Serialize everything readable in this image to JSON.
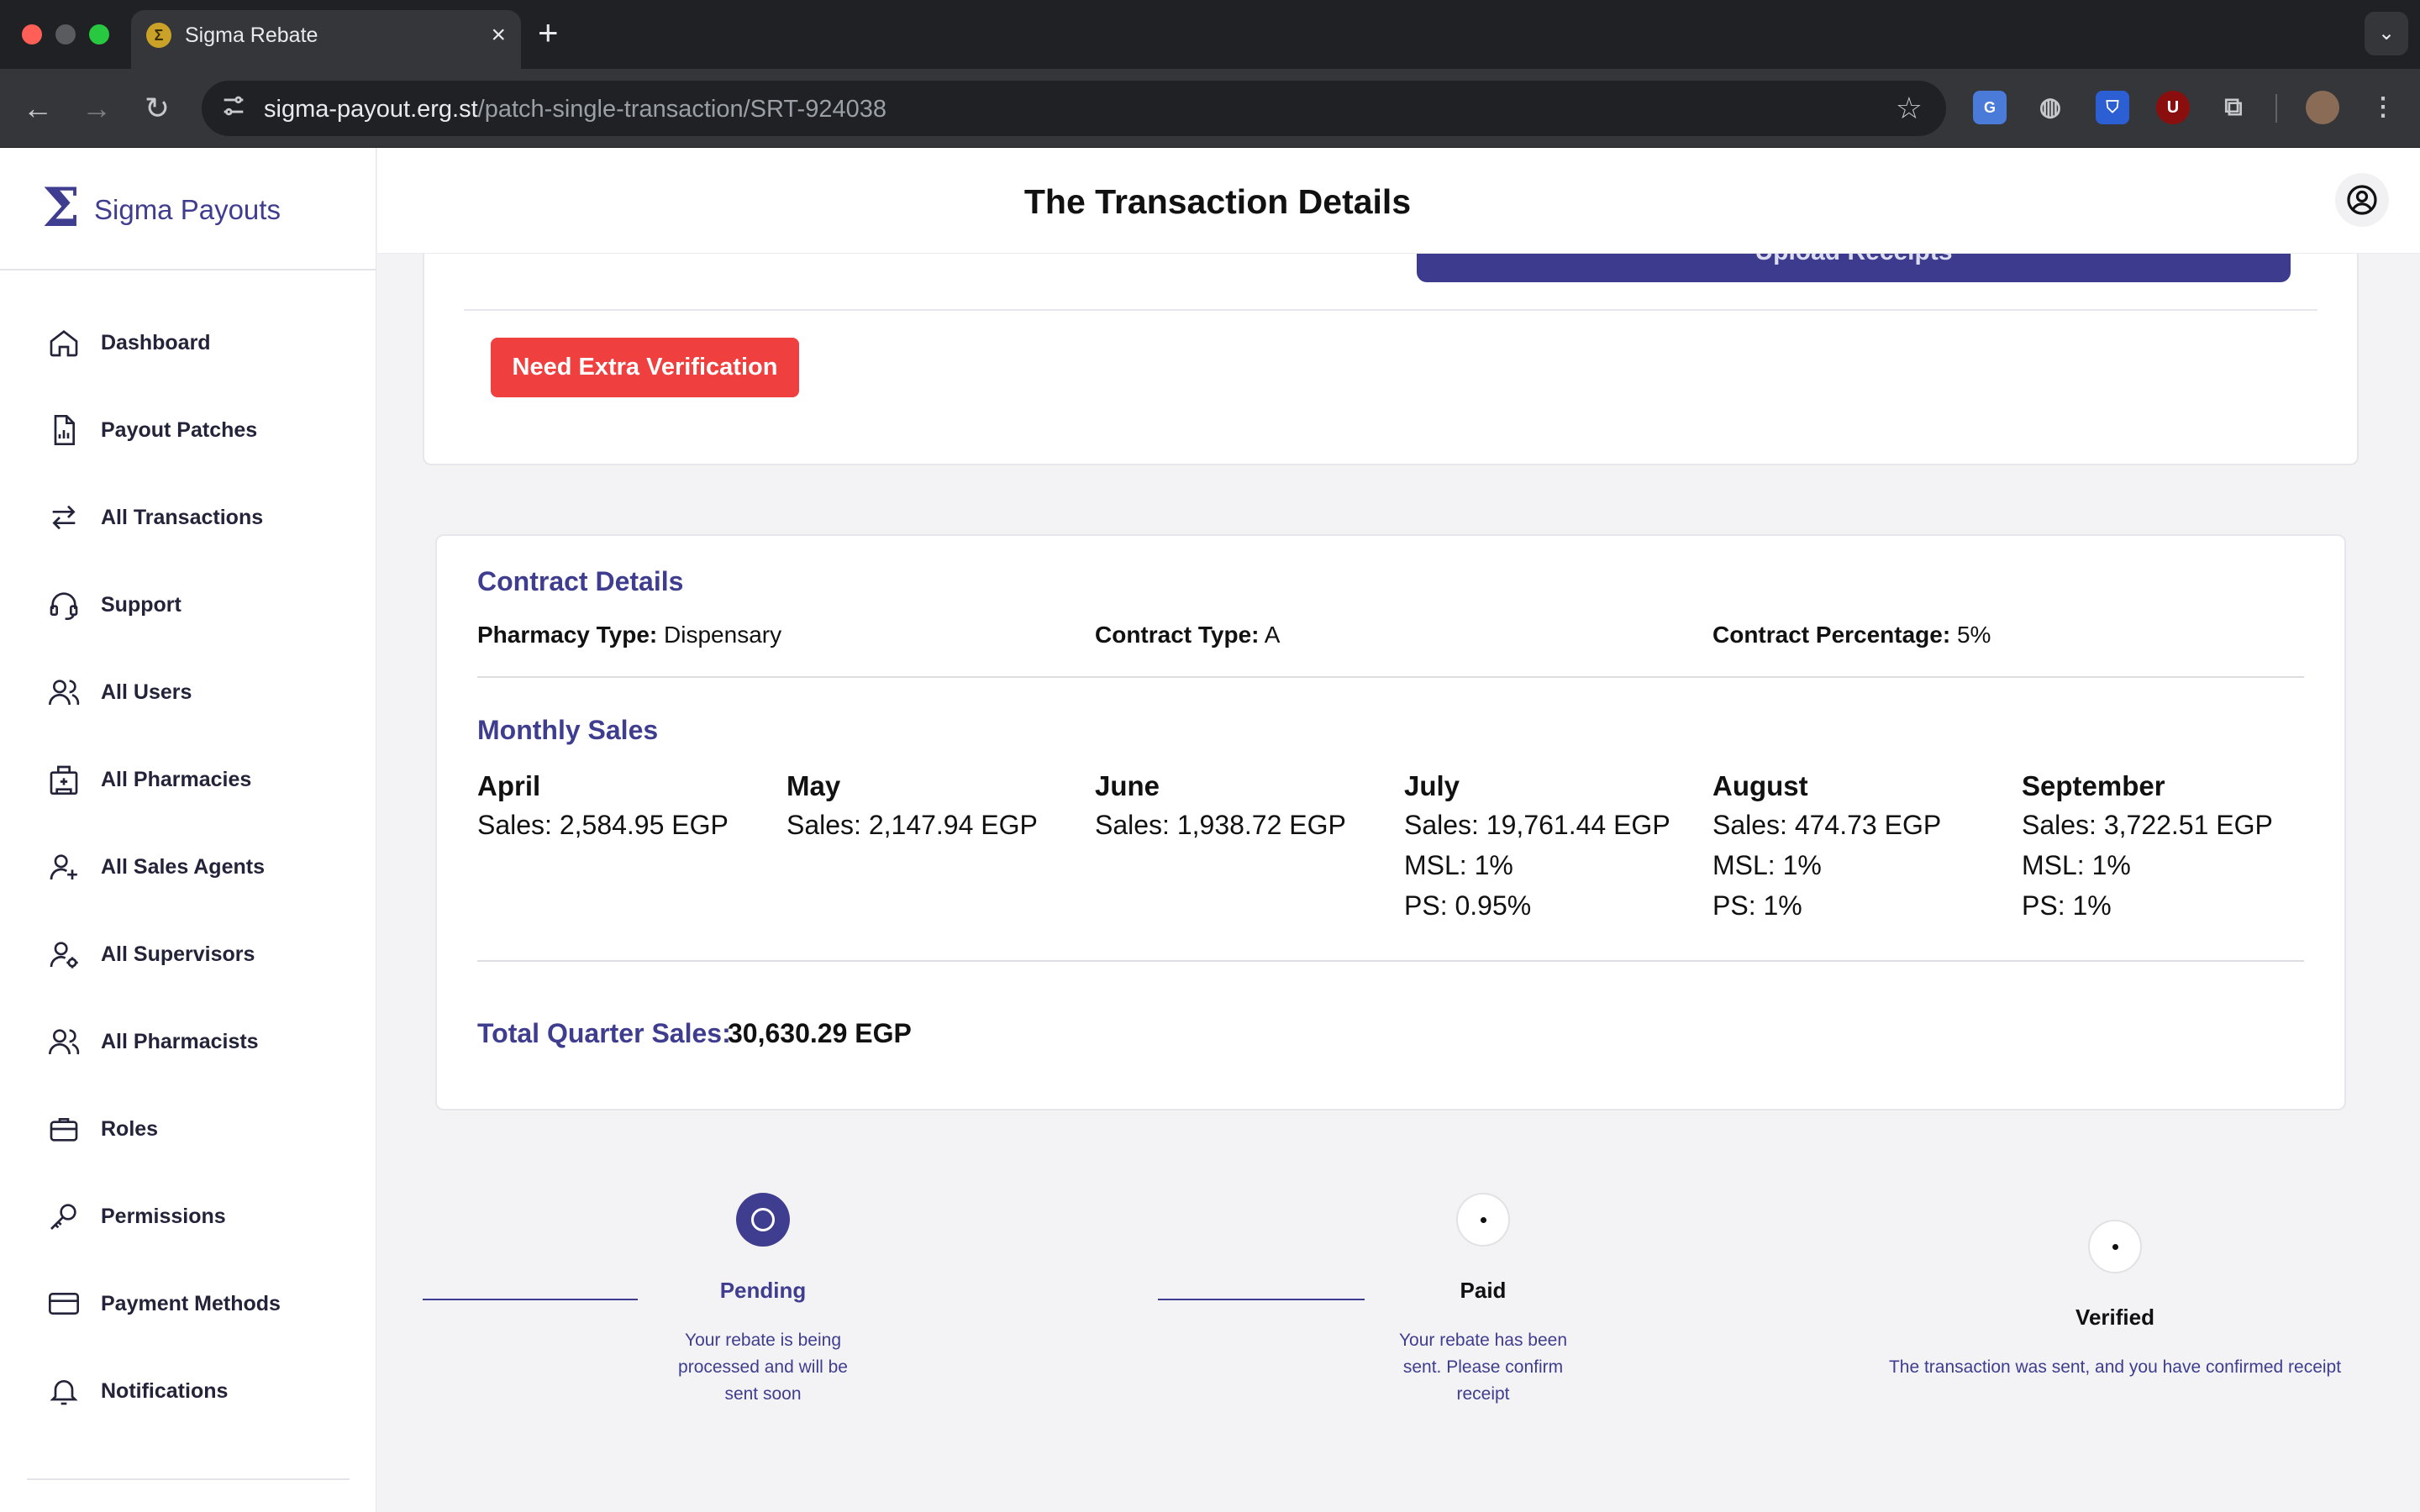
{
  "browser": {
    "tab_title": "Sigma Rebate",
    "favicon_glyph": "Σ",
    "url_host": "sigma-payout.erg.st",
    "url_path": "/patch-single-transaction/SRT-924038",
    "extension_u_label": "U"
  },
  "sidebar": {
    "brand_glyph": "Σ",
    "brand_name": "Sigma Payouts",
    "items": [
      {
        "label": "Dashboard",
        "icon": "home-icon"
      },
      {
        "label": "Payout Patches",
        "icon": "document-chart-icon"
      },
      {
        "label": "All Transactions",
        "icon": "arrows-exchange-icon"
      },
      {
        "label": "Support",
        "icon": "headset-icon"
      },
      {
        "label": "All Users",
        "icon": "users-icon"
      },
      {
        "label": "All Pharmacies",
        "icon": "building-icon"
      },
      {
        "label": "All Sales Agents",
        "icon": "user-plus-icon"
      },
      {
        "label": "All Supervisors",
        "icon": "user-gear-icon"
      },
      {
        "label": "All Pharmacists",
        "icon": "users-icon"
      },
      {
        "label": "Roles",
        "icon": "briefcase-icon"
      },
      {
        "label": "Permissions",
        "icon": "key-icon"
      },
      {
        "label": "Payment Methods",
        "icon": "credit-card-icon"
      },
      {
        "label": "Notifications",
        "icon": "bell-icon"
      }
    ]
  },
  "header": {
    "title": "The Transaction Details"
  },
  "top_card": {
    "upload_label": "Upload Receipts",
    "verify_label": "Need Extra Verification"
  },
  "contract": {
    "title": "Contract Details",
    "pharmacy_type_label": "Pharmacy Type:",
    "pharmacy_type_value": "Dispensary",
    "contract_type_label": "Contract Type:",
    "contract_type_value": "A",
    "contract_percentage_label": "Contract Percentage:",
    "contract_percentage_value": "5%"
  },
  "monthly_sales": {
    "title": "Monthly Sales",
    "months": [
      {
        "name": "April",
        "sales": "Sales: 2,584.95 EGP",
        "msl": "",
        "ps": ""
      },
      {
        "name": "May",
        "sales": "Sales: 2,147.94 EGP",
        "msl": "",
        "ps": ""
      },
      {
        "name": "June",
        "sales": "Sales: 1,938.72 EGP",
        "msl": "",
        "ps": ""
      },
      {
        "name": "July",
        "sales": "Sales: 19,761.44 EGP",
        "msl": "MSL: 1%",
        "ps": "PS: 0.95%"
      },
      {
        "name": "August",
        "sales": "Sales: 474.73 EGP",
        "msl": "MSL: 1%",
        "ps": "PS: 1%"
      },
      {
        "name": "September",
        "sales": "Sales: 3,722.51 EGP",
        "msl": "MSL: 1%",
        "ps": "PS: 1%"
      }
    ]
  },
  "total": {
    "label": "Total Quarter Sales:",
    "value": "30,630.29 EGP"
  },
  "steps": [
    {
      "label": "Pending",
      "desc": "Your rebate is being processed and will be sent soon",
      "state": "active"
    },
    {
      "label": "Paid",
      "desc": "Your rebate has been sent. Please confirm receipt",
      "state": "idle"
    },
    {
      "label": "Verified",
      "desc": "The transaction was sent, and you have confirmed receipt",
      "state": "idle"
    }
  ],
  "colors": {
    "brand": "#3f3d8f",
    "danger": "#ef3f3f",
    "text": "#111111"
  }
}
